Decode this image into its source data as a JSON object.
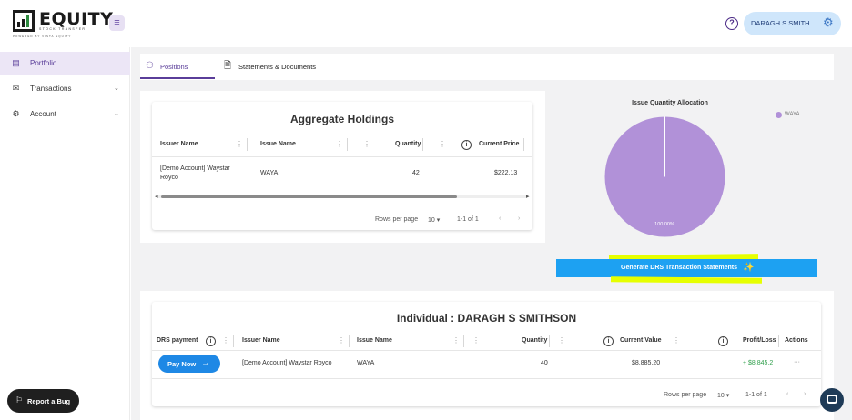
{
  "header": {
    "logo_text": "EQUITY",
    "logo_subtitle": "STOCK TRANSFER",
    "logo_powered": "POWERED BY VISTA EQUITY",
    "menu_icon": "hamburger-icon",
    "help_icon": "question-circle-icon",
    "user_name": "DARAGH S SMITH...",
    "user_gear_icon": "gear-icon"
  },
  "sidebar": {
    "items": [
      {
        "label": "Portfolio",
        "icon": "briefcase-icon",
        "active": true
      },
      {
        "label": "Transactions",
        "icon": "envelope-icon",
        "chevron": "chevron-down-icon"
      },
      {
        "label": "Account",
        "icon": "gear-icon",
        "chevron": "chevron-down-icon"
      }
    ],
    "report_bug": "Report a Bug"
  },
  "tabs": [
    {
      "label": "Positions",
      "icon": "people-icon",
      "active": true
    },
    {
      "label": "Statements & Documents",
      "icon": "document-icon",
      "active": false
    }
  ],
  "aggregate": {
    "title": "Aggregate Holdings",
    "columns": [
      "Issuer Name",
      "Issue Name",
      "Quantity",
      "Current Price"
    ],
    "row": {
      "issuer_line1": "[Demo Account] Waystar",
      "issuer_line2": "Royco",
      "issue": "WAYA",
      "quantity": "42",
      "price": "$222.13"
    },
    "pager": {
      "rows_per_page_label": "Rows per page",
      "rows_per_page": "10",
      "range": "1-1 of 1"
    }
  },
  "chart": {
    "title": "Issue Quantity Allocation",
    "legend_label": "WAYA",
    "slice_label": "100.00%",
    "slice_color": "#b191d8",
    "generate_button": "Generate DRS Transaction Statements"
  },
  "chart_data": {
    "type": "pie",
    "title": "Issue Quantity Allocation",
    "categories": [
      "WAYA"
    ],
    "values": [
      100.0
    ],
    "legend_position": "top-right"
  },
  "individual": {
    "title": "Individual : DARAGH S SMITHSON",
    "columns": [
      "DRS payment",
      "Issuer Name",
      "Issue Name",
      "Quantity",
      "Current Value",
      "Profit/Loss",
      "Actions"
    ],
    "row": {
      "pay_button": "Pay Now",
      "issuer": "[Demo Account] Waystar Royco",
      "issue": "WAYA",
      "quantity": "40",
      "current_value": "$8,885.20",
      "profit_loss": "+ $8,845.2",
      "actions": "···"
    },
    "pager": {
      "rows_per_page_label": "Rows per page",
      "rows_per_page": "10",
      "range": "1-1 of 1"
    }
  }
}
